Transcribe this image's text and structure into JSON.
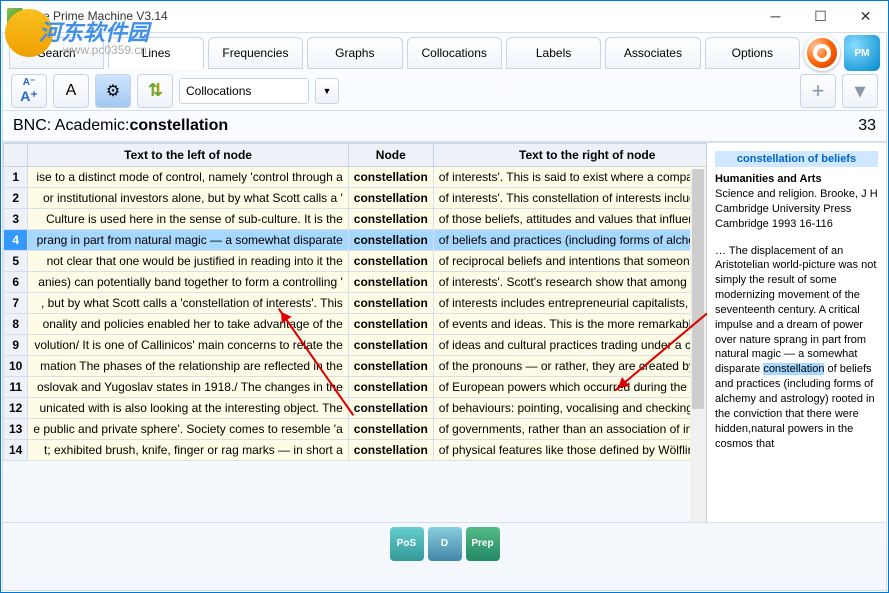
{
  "window": {
    "title": "The Prime Machine V3.14"
  },
  "watermark": {
    "name": "河东软件园",
    "url": "www.pc0359.cn"
  },
  "tabs": [
    "Search",
    "Lines",
    "Frequencies",
    "Graphs",
    "Collocations",
    "Labels",
    "Associates",
    "Options"
  ],
  "toolbar": {
    "combo_value": "Collocations"
  },
  "query": {
    "corpus": "BNC: Academic: ",
    "word": "constellation",
    "count": "33"
  },
  "headers": {
    "left": "Text to the left of node",
    "node": "Node",
    "right": "Text to the right of node"
  },
  "rows": [
    {
      "n": "1",
      "l": "ise to a distinct mode of control, namely 'control through a",
      "node": "constellation",
      "r": "of interests'. This is said to exist where a company has"
    },
    {
      "n": "2",
      "l": "or institutional investors alone, but by what Scott calls a '",
      "node": "constellation",
      "r": "of interests'. This constellation of interests includes ent"
    },
    {
      "n": "3",
      "l": "Culture is used here in the sense of sub-culture. It is the",
      "node": "constellation",
      "r": "of those beliefs, attitudes and values that influence sul"
    },
    {
      "n": "4",
      "l": "prang in part from natural magic — a somewhat disparate",
      "node": "constellation",
      "r": "of beliefs and practices (including forms of alchemy and"
    },
    {
      "n": "5",
      "l": "not clear that one would be justified in reading into it the",
      "node": "constellation",
      "r": "of reciprocal beliefs and intentions that someone like Le"
    },
    {
      "n": "6",
      "l": "anies) can potentially band together to form a controlling '",
      "node": "constellation",
      "r": "of interests'. Scott's research show that among the top"
    },
    {
      "n": "7",
      "l": ", but by what Scott calls a 'constellation of interests'. This",
      "node": "constellation",
      "r": "of interests includes entrepreneurial capitalists, interna"
    },
    {
      "n": "8",
      "l": "onality and policies enabled her to take advantage of the",
      "node": "constellation",
      "r": "of events and ideas. This is the more remarkable in viev"
    },
    {
      "n": "9",
      "l": "volution/ It is one of Callinicos' main concerns to relate the",
      "node": "constellation",
      "r": "of ideas and cultural practices trading under a concepti"
    },
    {
      "n": "10",
      "l": "mation The phases of the relationship are reflected in the",
      "node": "constellation",
      "r": "of the pronouns — or rather, they are created by the p"
    },
    {
      "n": "11",
      "l": "oslovak and Yugoslav states in 1918./ The changes in the",
      "node": "constellation",
      "r": "of European powers which occurred during the eightee"
    },
    {
      "n": "12",
      "l": "unicated with is also looking at the interesting object. The",
      "node": "constellation",
      "r": "of behaviours: pointing, vocalising and checking may be"
    },
    {
      "n": "13",
      "l": "e public and private sphere'. Society comes to resemble 'a",
      "node": "constellation",
      "r": "of governments, rather than an association of individua"
    },
    {
      "n": "14",
      "l": "t; exhibited brush, knife, finger or rag marks — in short a",
      "node": "constellation",
      "r": "of physical features like those defined by Wölflinn when"
    }
  ],
  "selected_row": 3,
  "side": {
    "title": "constellation of beliefs",
    "subtitle": "Humanities and Arts",
    "source": "Science and religion. Brooke, J H Cambridge University Press Cambridge 1993 16-116",
    "body_pre": "… The displacement of an Aristotelian world-picture was not simply the result of some modernizing movement of the seventeenth century. A critical impulse and a dream of power over nature sprang in part from natural magic — a somewhat disparate ",
    "body_hl": "constellation",
    "body_post": " of beliefs and practices (including forms of alchemy and astrology) rooted in the conviction that there were hidden,natural powers in the cosmos that"
  },
  "bottom_buttons": [
    "PoS",
    "D",
    "Prep"
  ],
  "chart_data": null
}
